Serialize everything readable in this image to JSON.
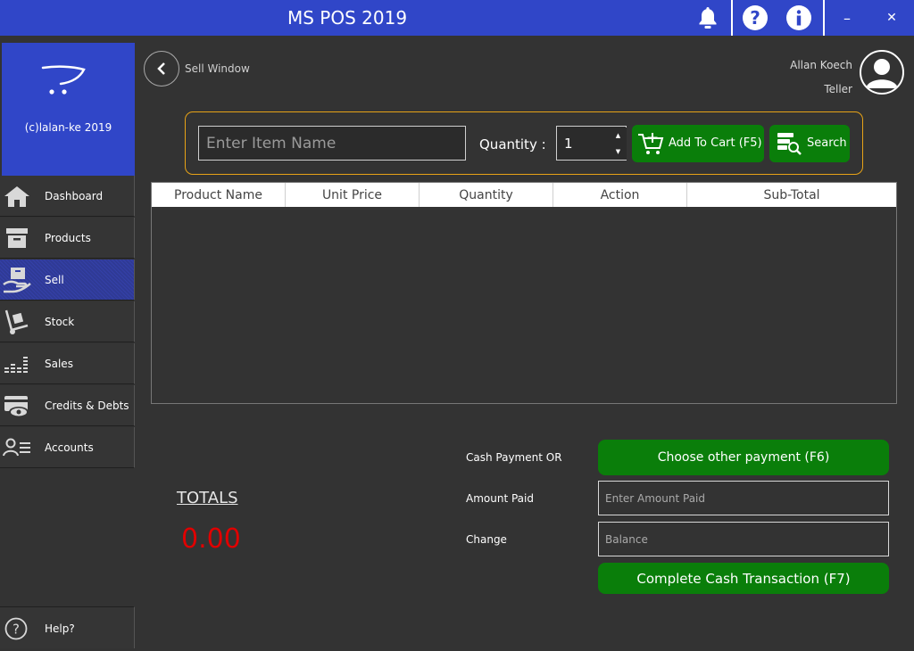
{
  "window": {
    "title": "MS POS 2019",
    "icons": [
      "bell-icon",
      "help-icon",
      "info-icon",
      "minimize-icon",
      "close-icon"
    ],
    "minimize_glyph": "–",
    "close_glyph": "✕"
  },
  "sidebar": {
    "brand_text": "(c)lalan-ke 2019",
    "items": [
      {
        "label": "Dashboard",
        "icon": "house-icon"
      },
      {
        "label": "Products",
        "icon": "archive-box-icon"
      },
      {
        "label": "Sell",
        "icon": "hand-box-icon",
        "active": true
      },
      {
        "label": "Stock",
        "icon": "hand-truck-icon"
      },
      {
        "label": "Sales",
        "icon": "bar-chart-icon"
      },
      {
        "label": "Credits & Debts",
        "icon": "card-eye-icon"
      },
      {
        "label": "Accounts",
        "icon": "user-list-icon"
      }
    ],
    "help_label": "Help?"
  },
  "header": {
    "window_title": "Sell Window",
    "user_name": "Allan Koech",
    "user_role": "Teller"
  },
  "search": {
    "item_placeholder": "Enter Item Name",
    "quantity_label": "Quantity :",
    "quantity_value": "1",
    "add_to_cart_label": "Add To Cart (F5)",
    "search_label": "Search"
  },
  "table": {
    "columns": [
      "Product Name",
      "Unit Price",
      "Quantity",
      "Action",
      "Sub-Total"
    ],
    "rows": []
  },
  "totals": {
    "label": "TOTALS",
    "value": "0.00"
  },
  "payment": {
    "cash_label": "Cash Payment OR",
    "other_payment_label": "Choose other payment (F6)",
    "amount_label": "Amount Paid",
    "amount_placeholder": "Enter Amount Paid",
    "change_label": "Change",
    "change_placeholder": "Balance",
    "complete_label": "Complete Cash Transaction (F7)"
  },
  "colors": {
    "accent_blue": "#3046c8",
    "action_green": "#0a7e0a",
    "panel_border": "#e8a317",
    "totals_red": "#e00000",
    "background": "#333333"
  }
}
